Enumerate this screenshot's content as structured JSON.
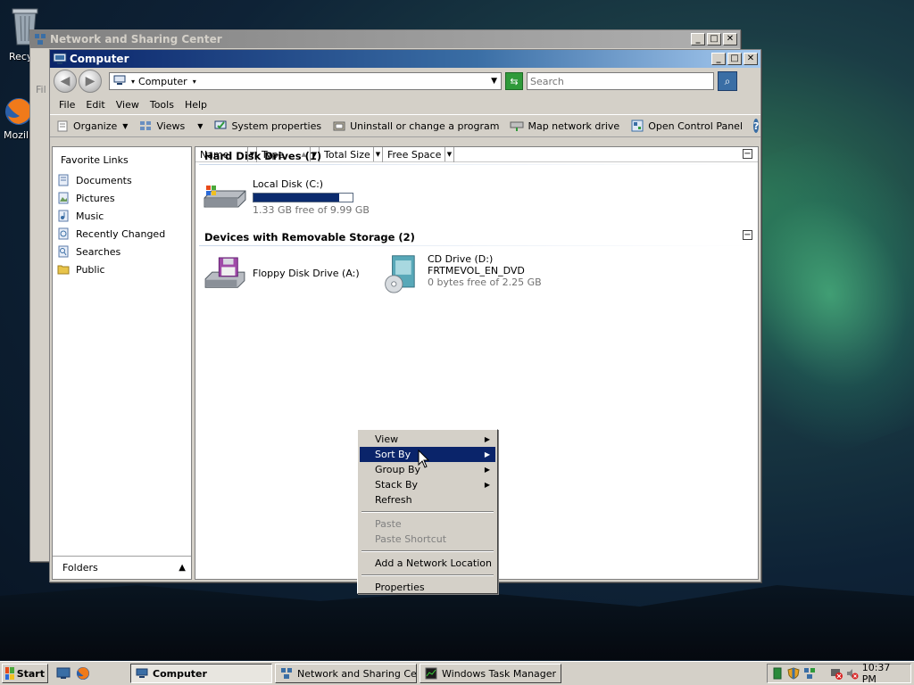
{
  "desktop": {
    "icons": [
      {
        "label": "Recy",
        "icon": "recycle-bin-icon"
      },
      {
        "label": "Mozilla",
        "icon": "firefox-icon"
      }
    ]
  },
  "back_window": {
    "title": "Network and Sharing Center",
    "menu_partial": "Fil"
  },
  "window": {
    "title": "Computer",
    "address": "Computer",
    "search_placeholder": "Search",
    "menu": [
      "File",
      "Edit",
      "View",
      "Tools",
      "Help"
    ],
    "toolbar": {
      "organize": "Organize",
      "views": "Views",
      "system_properties": "System properties",
      "uninstall": "Uninstall or change a program",
      "map_drive": "Map network drive",
      "control_panel": "Open Control Panel"
    },
    "nav": {
      "header": "Favorite Links",
      "items": [
        {
          "label": "Documents",
          "icon": "documents-icon"
        },
        {
          "label": "Pictures",
          "icon": "pictures-icon"
        },
        {
          "label": "Music",
          "icon": "music-icon"
        },
        {
          "label": "Recently Changed",
          "icon": "recently-changed-icon"
        },
        {
          "label": "Searches",
          "icon": "searches-icon"
        },
        {
          "label": "Public",
          "icon": "public-folder-icon"
        }
      ],
      "folders": "Folders"
    },
    "columns": [
      "Name",
      "Type",
      "Total Size",
      "Free Space"
    ],
    "groups": {
      "hdd": {
        "title": "Hard Disk Drives (1)",
        "drives": [
          {
            "name": "Local Disk (C:)",
            "free": "1.33 GB free of 9.99 GB",
            "used_fraction": 0.867
          }
        ]
      },
      "removable": {
        "title": "Devices with Removable Storage (2)",
        "drives": [
          {
            "name": "Floppy Disk Drive (A:)"
          },
          {
            "name": "CD Drive (D:)",
            "label": "FRTMEVOL_EN_DVD",
            "free": "0 bytes free of 2.25 GB"
          }
        ]
      }
    }
  },
  "context_menu": {
    "items": [
      {
        "label": "View",
        "submenu": true
      },
      {
        "label": "Sort By",
        "submenu": true,
        "highlighted": true
      },
      {
        "label": "Group By",
        "submenu": true
      },
      {
        "label": "Stack By",
        "submenu": true
      },
      {
        "label": "Refresh"
      },
      {
        "label": "Paste",
        "disabled": true
      },
      {
        "label": "Paste Shortcut",
        "disabled": true
      },
      {
        "label": "Add a Network Location"
      },
      {
        "label": "Properties"
      }
    ]
  },
  "taskbar": {
    "start": "Start",
    "tasks": [
      {
        "label": "Computer",
        "active": true
      },
      {
        "label": "Network and Sharing Ce..."
      },
      {
        "label": "Windows Task Manager"
      }
    ],
    "clock": "10:37 PM"
  },
  "colors": {
    "title_active": "#0a246a",
    "menu_highlight": "#0a246a",
    "disk_fill": "#0b2b6e"
  }
}
